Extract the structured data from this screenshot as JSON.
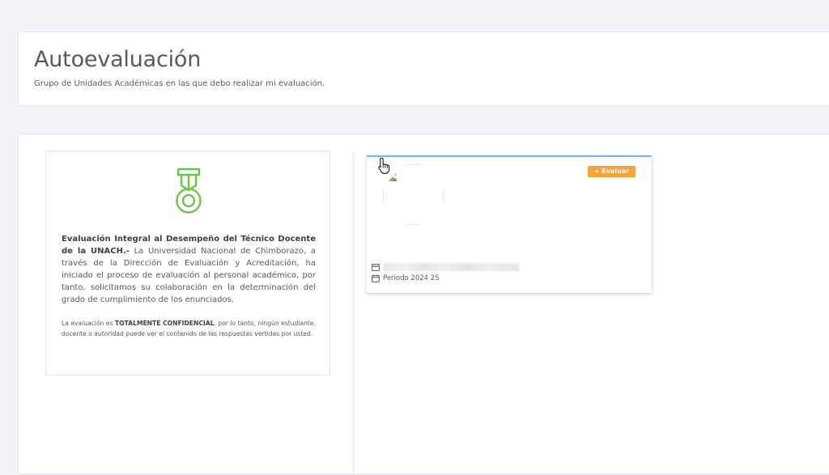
{
  "header": {
    "title": "Autoevaluación",
    "subtitle": "Grupo de Unidades Académicas en las que debo realizar mi evaluación."
  },
  "info": {
    "icon": "medal-icon",
    "accent_color": "#6cc24a",
    "main_bold": "Evaluación Integral al Desempeño del Técnico Docente de la UNACH.-",
    "main_text": " La Universidad Nacional de Chimborazo, a través de la Dirección de Evaluación y Acreditación, ha iniciado el proceso de evaluación al personal académico, por tanto, solicitamos su colaboración en la determinación del grado de cumplimiento de los enunciados.",
    "note_prefix": "La evaluación es ",
    "note_bold": "TOTALMENTE CONFIDENCIAL",
    "note_suffix": ", por lo tanto, ningún estudiante, docente o autoridad puede ver el contenido de las respuestas vertidas por usted."
  },
  "unit_card": {
    "evaluate_label": "+ Evaluar",
    "evaluate_color": "#f4a43b",
    "top_border_color": "#7fb4e6",
    "period": "Periodo 2024 2S"
  }
}
